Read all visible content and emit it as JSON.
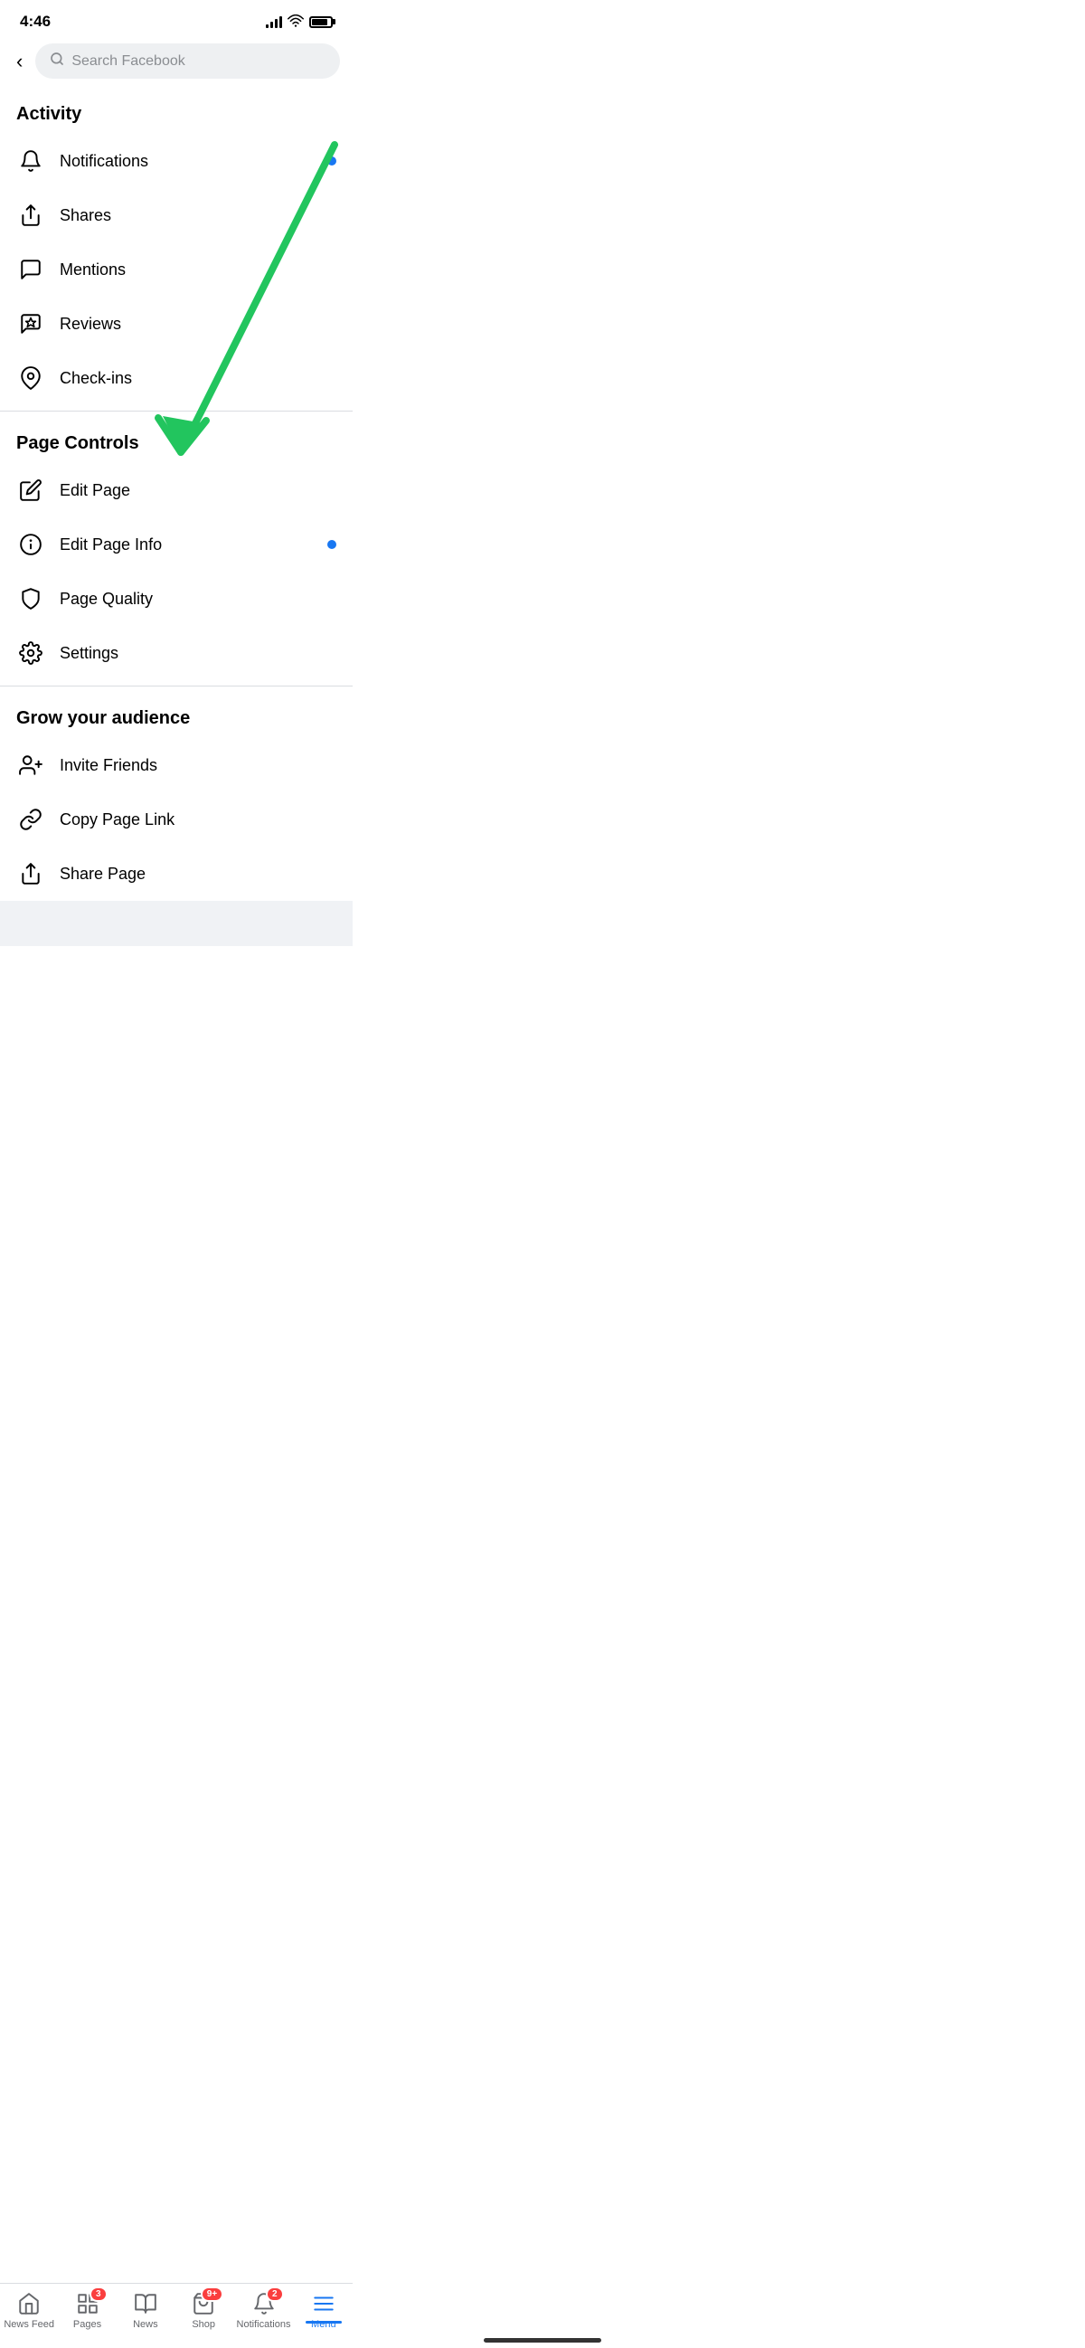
{
  "statusBar": {
    "time": "4:46"
  },
  "topNav": {
    "backLabel": "‹",
    "searchPlaceholder": "Search Facebook"
  },
  "sections": [
    {
      "id": "activity",
      "header": "Activity",
      "items": [
        {
          "id": "notifications",
          "label": "Notifications",
          "icon": "bell",
          "badge": true
        },
        {
          "id": "shares",
          "label": "Shares",
          "icon": "share",
          "badge": false
        },
        {
          "id": "mentions",
          "label": "Mentions",
          "icon": "chat",
          "badge": false
        },
        {
          "id": "reviews",
          "label": "Reviews",
          "icon": "star-bubble",
          "badge": false
        },
        {
          "id": "checkins",
          "label": "Check-ins",
          "icon": "location",
          "badge": false
        }
      ]
    },
    {
      "id": "page-controls",
      "header": "Page Controls",
      "items": [
        {
          "id": "edit-page",
          "label": "Edit Page",
          "icon": "pencil",
          "badge": false
        },
        {
          "id": "edit-page-info",
          "label": "Edit Page Info",
          "icon": "info-circle",
          "badge": true
        },
        {
          "id": "page-quality",
          "label": "Page Quality",
          "icon": "shield",
          "badge": false
        },
        {
          "id": "settings",
          "label": "Settings",
          "icon": "gear",
          "badge": false
        }
      ]
    },
    {
      "id": "grow-audience",
      "header": "Grow your audience",
      "items": [
        {
          "id": "invite-friends",
          "label": "Invite Friends",
          "icon": "person-plus",
          "badge": false
        },
        {
          "id": "copy-page-link",
          "label": "Copy Page Link",
          "icon": "link",
          "badge": false
        },
        {
          "id": "share-page",
          "label": "Share Page",
          "icon": "share",
          "badge": false
        }
      ]
    }
  ],
  "tabBar": {
    "tabs": [
      {
        "id": "news-feed",
        "label": "News Feed",
        "icon": "home",
        "badge": null,
        "active": false
      },
      {
        "id": "pages",
        "label": "Pages",
        "icon": "pages",
        "badge": "3",
        "active": false
      },
      {
        "id": "news",
        "label": "News",
        "icon": "news",
        "badge": null,
        "active": false
      },
      {
        "id": "shop",
        "label": "Shop",
        "icon": "shop",
        "badge": "9+",
        "active": false
      },
      {
        "id": "notifications-tab",
        "label": "Notifications",
        "icon": "bell-tab",
        "badge": "2",
        "active": false
      },
      {
        "id": "menu",
        "label": "Menu",
        "icon": "menu",
        "badge": null,
        "active": true
      }
    ]
  }
}
